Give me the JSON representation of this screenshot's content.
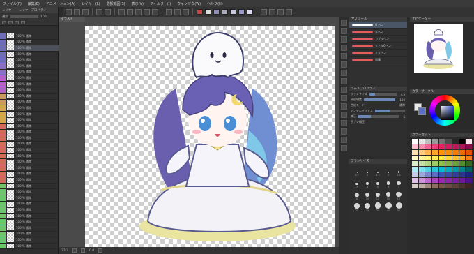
{
  "menu": [
    "ファイル(F)",
    "編集(E)",
    "アニメーション(A)",
    "レイヤー(L)",
    "選択範囲(S)",
    "表示(V)",
    "フィルター(I)",
    "ウィンドウ(W)",
    "ヘルプ(H)"
  ],
  "layers": {
    "header": [
      "レイヤー",
      "レイヤープロパティ"
    ],
    "mode": "通常",
    "opacity": "100",
    "rows": [
      {
        "text": "100 % 通常",
        "color": "#6e6eb8"
      },
      {
        "text": "100 % 通常",
        "color": "#6e6eb8"
      },
      {
        "text": "100 % 通常",
        "color": "#6e6eb8"
      },
      {
        "text": "100 % 通常",
        "color": "#6e6eb8"
      },
      {
        "text": "100 % 通常",
        "color": "#6e6eb8"
      },
      {
        "text": "100 % 通常",
        "color": "#8a6ec8"
      },
      {
        "text": "100 % 通常",
        "color": "#8a6ec8"
      },
      {
        "text": "100 % 通常",
        "color": "#b55fc8"
      },
      {
        "text": "100 % 通常",
        "color": "#b55fc8"
      },
      {
        "text": "100 % 通常",
        "color": "#b55fc8"
      },
      {
        "text": "100 % 通常",
        "color": "#c89a5f"
      },
      {
        "text": "100 % 通常",
        "color": "#c89a5f"
      },
      {
        "text": "100 % 通常",
        "color": "#d4a84a"
      },
      {
        "text": "100 % 通常",
        "color": "#d4a84a"
      },
      {
        "text": "100 % 通常",
        "color": "#d4a84a"
      },
      {
        "text": "100 % 通常",
        "color": "#d26b5a"
      },
      {
        "text": "100 % 通常",
        "color": "#d26b5a"
      },
      {
        "text": "100 % 通常",
        "color": "#d26b5a"
      },
      {
        "text": "100 % 通常",
        "color": "#d26b5a"
      },
      {
        "text": "100 % 通常",
        "color": "#d26b5a"
      },
      {
        "text": "100 % 通常",
        "color": "#d26b5a"
      },
      {
        "text": "100 % 通常",
        "color": "#d26b5a"
      },
      {
        "text": "100 % 通常",
        "color": "#d26b5a"
      },
      {
        "text": "100 % 通常",
        "color": "#d26b5a"
      },
      {
        "text": "100 % 通常",
        "color": "#d26b5a"
      },
      {
        "text": "100 % 通常",
        "color": "#6cc66c"
      },
      {
        "text": "100 % 通常",
        "color": "#6cc66c"
      },
      {
        "text": "100 % 通常",
        "color": "#6cc66c"
      },
      {
        "text": "100 % 通常",
        "color": "#6cc66c"
      },
      {
        "text": "100 % 通常",
        "color": "#6cc66c"
      },
      {
        "text": "100 % 通常",
        "color": "#6cc66c"
      },
      {
        "text": "100 % 通常",
        "color": "#6cc66c"
      },
      {
        "text": "100 % 通常",
        "color": "#6cc66c"
      },
      {
        "text": "100 % 通常",
        "color": "#6cc66c"
      },
      {
        "text": "100 % 通常",
        "color": "#6cc66c"
      },
      {
        "text": "100 % 通常",
        "color": "#6cc66c"
      }
    ]
  },
  "subtool": {
    "title": "サブツール",
    "brushes": [
      {
        "label": "G ペン",
        "color": "#ffffff"
      },
      {
        "label": "丸ペン",
        "color": "#e45c5c"
      },
      {
        "label": "カブラペン",
        "color": "#e45c5c"
      },
      {
        "label": "リアルGペン",
        "color": "#e45c5c"
      },
      {
        "label": "ミリペン",
        "color": "#e45c5c"
      },
      {
        "label": "鉛筆",
        "color": "#e45c5c"
      }
    ]
  },
  "toolprop": {
    "title": "ツールプロパティ",
    "rows": [
      {
        "label": "ブラシサイズ",
        "value": "4.5",
        "fill": 0.2
      },
      {
        "label": "不透明度",
        "value": "100",
        "fill": 1.0
      },
      {
        "label": "合成モード",
        "value": "通常",
        "fill": 0
      },
      {
        "label": "アンチエイリアス",
        "value": "",
        "fill": 0.5
      },
      {
        "label": "補正",
        "value": "6",
        "fill": 0.3
      },
      {
        "label": "手ブレ補正",
        "value": "",
        "fill": 0
      }
    ]
  },
  "brushsize": {
    "title": "ブラシサイズ",
    "sizes": [
      "0.7",
      "1",
      "1.5",
      "2",
      "2.5",
      "3",
      "4",
      "5",
      "6",
      "7",
      "8",
      "10",
      "12",
      "15",
      "17",
      "20",
      "25",
      "30",
      "40",
      "50"
    ]
  },
  "navigator": {
    "title": "ナビゲーター"
  },
  "colorwheel": {
    "title": "カラーサークル",
    "main": "#e8e8e8",
    "sub": "#5c70c8"
  },
  "colorsets": {
    "title": "カラーセット",
    "colors": [
      "#ffffff",
      "#e6e6e6",
      "#bfbfbf",
      "#999999",
      "#737373",
      "#4d4d4d",
      "#262626",
      "#000000",
      "#fce4ec",
      "#f8bbd0",
      "#f48fb1",
      "#f06292",
      "#ec407a",
      "#e91e63",
      "#d81b60",
      "#c2185b",
      "#ad1457",
      "#880e4f",
      "#ffe0b2",
      "#ffcc80",
      "#ffb74d",
      "#ffa726",
      "#ff9800",
      "#fb8c00",
      "#f57c00",
      "#ef6c00",
      "#e65100",
      "#fff9c4",
      "#fff59d",
      "#fff176",
      "#ffee58",
      "#ffeb3b",
      "#fdd835",
      "#fbc02d",
      "#f9a825",
      "#f57f17",
      "#dcedc8",
      "#c5e1a5",
      "#aed581",
      "#9ccc65",
      "#8bc34a",
      "#7cb342",
      "#689f38",
      "#558b2f",
      "#33691e",
      "#b2ebf2",
      "#80deea",
      "#4dd0e1",
      "#26c6da",
      "#00bcd4",
      "#00acc1",
      "#0097a7",
      "#00838f",
      "#006064",
      "#c5cae9",
      "#9fa8da",
      "#7986cb",
      "#5c6bc0",
      "#3f51b5",
      "#3949ab",
      "#303f9f",
      "#283593",
      "#1a237e",
      "#e1bee7",
      "#ce93d8",
      "#ba68c8",
      "#ab47bc",
      "#9c27b0",
      "#8e24aa",
      "#7b1fa2",
      "#6a1b9a",
      "#4a148c",
      "#d7ccc8",
      "#bcaaa4",
      "#a1887f",
      "#8d6e63",
      "#795548",
      "#6d4c41",
      "#5d4037",
      "#4e342e",
      "#3e2723"
    ]
  },
  "canvas": {
    "tab": "イラスト"
  },
  "status": {
    "zoom": "33.3",
    "angle": "0.0"
  }
}
